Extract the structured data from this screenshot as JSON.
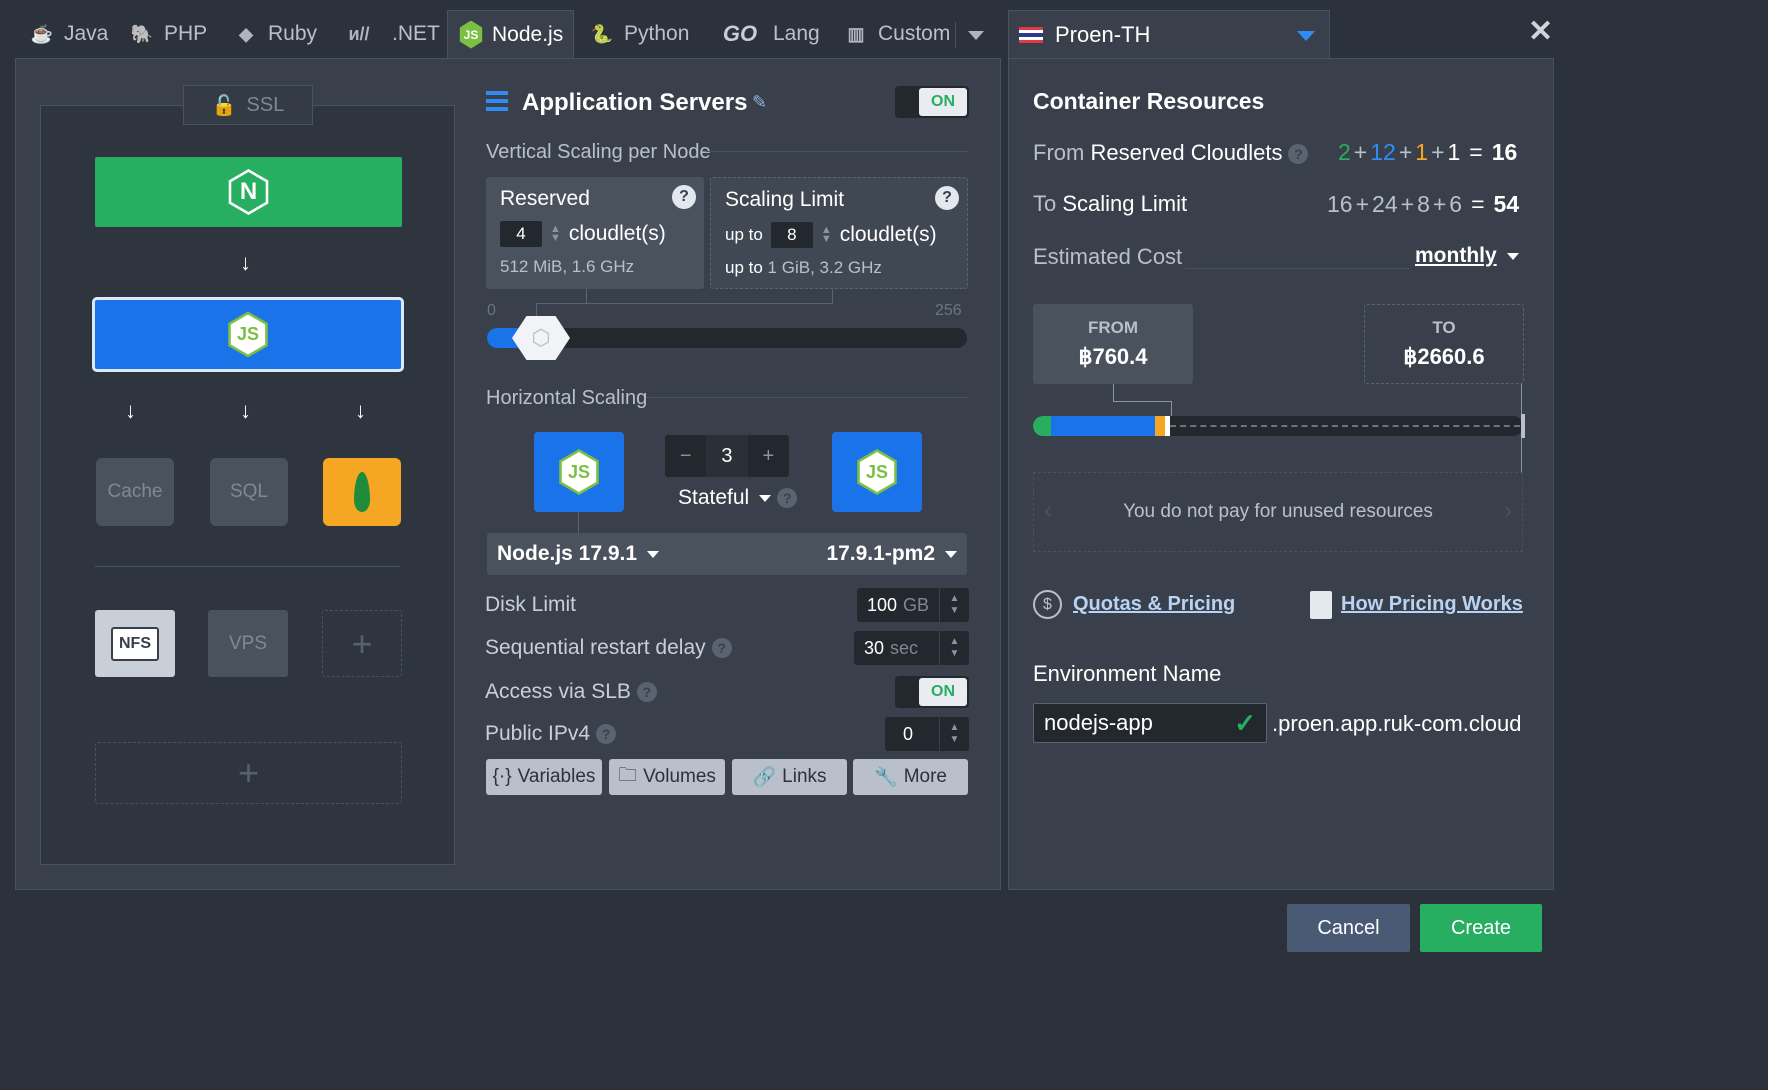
{
  "tabs": [
    {
      "label": "Java",
      "icon": "java-icon"
    },
    {
      "label": "PHP",
      "icon": "php-elephant-icon"
    },
    {
      "label": "Ruby",
      "icon": "ruby-icon"
    },
    {
      "label": ".NET",
      "icon": "dotnet-icon"
    },
    {
      "label": "Node.js",
      "icon": "nodejs-icon",
      "active": true
    },
    {
      "label": "Python",
      "icon": "python-icon"
    },
    {
      "label": "Lang",
      "prefix": "GO",
      "icon": "go-icon"
    },
    {
      "label": "Custom",
      "icon": "custom-grid-icon"
    }
  ],
  "region": {
    "name": "Proen-TH"
  },
  "topology": {
    "ssl": "SSL",
    "nginx_letter": "N",
    "node_letters": "JS",
    "cache": "Cache",
    "sql": "SQL",
    "nfs": "NFS",
    "vps": "VPS",
    "add": "+"
  },
  "app_servers": {
    "title": "Application Servers",
    "toggle": "ON",
    "vertical_label": "Vertical Scaling per Node",
    "reserved": {
      "title": "Reserved",
      "value": "4",
      "unit": "cloudlet(s)",
      "spec": "512 MiB, 1.6 GHz",
      "help": "?"
    },
    "limit": {
      "title": "Scaling Limit",
      "prefix": "up to",
      "value": "8",
      "unit": "cloudlet(s)",
      "spec_prefix": "up to",
      "spec": "1 GiB, 3.2 GHz",
      "help": "?"
    },
    "slider": {
      "min": "0",
      "max": "256",
      "reserved_fraction": 0.0156,
      "limit_fraction": 0.0313
    },
    "horizontal_label": "Horizontal Scaling",
    "node_count": "3",
    "minus": "−",
    "plus": "+",
    "mode": "Stateful",
    "version": "Node.js 17.9.1",
    "tag": "17.9.1-pm2",
    "disk": {
      "label": "Disk Limit",
      "value": "100",
      "unit": "GB"
    },
    "restart": {
      "label": "Sequential restart delay",
      "value": "30",
      "unit": "sec"
    },
    "slb": {
      "label": "Access via SLB",
      "toggle": "ON"
    },
    "ipv4": {
      "label": "Public IPv4",
      "value": "0"
    },
    "buttons": {
      "variables": "Variables",
      "volumes": "Volumes",
      "links": "Links",
      "more": "More"
    }
  },
  "resources": {
    "title": "Container Resources",
    "from_label_pre": "From",
    "from_label": "Reserved Cloudlets",
    "from_terms": [
      "2",
      "12",
      "1",
      "1"
    ],
    "from_total": "16",
    "to_label_pre": "To",
    "to_label": "Scaling Limit",
    "to_terms": [
      "16",
      "24",
      "8",
      "6"
    ],
    "to_total": "54",
    "plus": "+",
    "equals": "=",
    "cost_label": "Estimated Cost",
    "period": "monthly",
    "from_box": {
      "label": "FROM",
      "price": "฿760.4"
    },
    "to_box": {
      "label": "TO",
      "price": "฿2660.6"
    },
    "unused_note": "You do not pay for unused resources",
    "quotas_link": "Quotas & Pricing",
    "how_link": "How Pricing Works",
    "env_label": "Environment Name",
    "env_value": "nodejs-app",
    "env_domain": ".proen.app.ruk-com.cloud",
    "colors": {
      "green": "#27ae60",
      "blue": "#1a73e8",
      "orange": "#f5a623",
      "white": "#ffffff"
    }
  },
  "footer": {
    "cancel": "Cancel",
    "create": "Create"
  }
}
